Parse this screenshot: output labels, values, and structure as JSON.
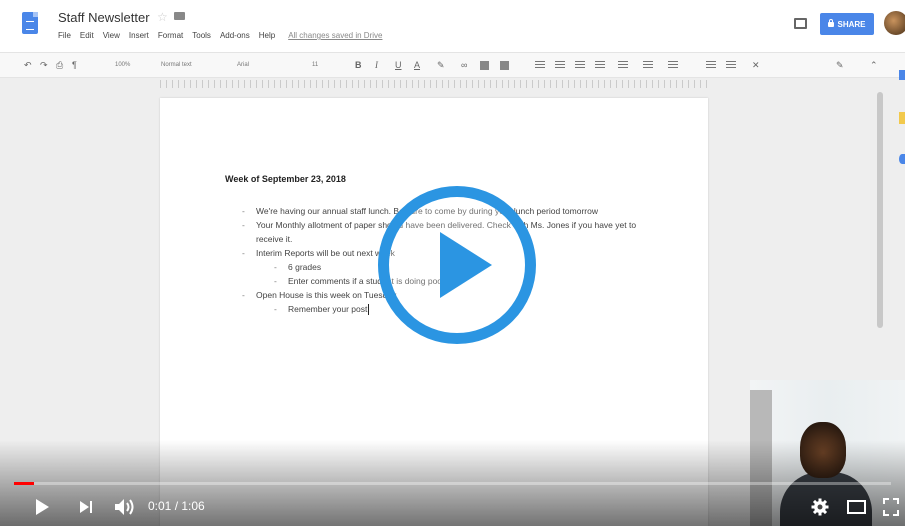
{
  "docs": {
    "title": "Staff Newsletter",
    "menu": [
      "File",
      "Edit",
      "View",
      "Insert",
      "Format",
      "Tools",
      "Add-ons",
      "Help"
    ],
    "save_status": "All changes saved in Drive",
    "share_label": "SHARE",
    "toolbar": {
      "zoom": "100%",
      "style": "Normal text",
      "font": "Arial",
      "font_size": "11"
    }
  },
  "document": {
    "heading": "Week of September 23, 2018",
    "items": [
      {
        "text": "We're having our annual staff lunch. Be sure to come by during your lunch period tomorrow",
        "level": 1
      },
      {
        "text": "Your Monthly allotment of paper should have been delivered. Check with Ms. Jones if you have yet to receive it.",
        "level": 1
      },
      {
        "text": "Interim Reports will be out next week",
        "level": 1
      },
      {
        "text": "6 grades",
        "level": 2
      },
      {
        "text": "Enter comments if a student is doing poorly",
        "level": 2
      },
      {
        "text": "Open House is this week on Tuesday",
        "level": 1
      },
      {
        "text": "Remember your post",
        "level": 2
      }
    ]
  },
  "player": {
    "time": "0:01 / 1:06",
    "progress": 0.015,
    "colors": {
      "progress": "#ff0000",
      "play_overlay": "#2b95e2"
    }
  },
  "icons": [
    "docs-logo-icon",
    "star-icon",
    "folder-icon",
    "comment-icon",
    "lock-icon",
    "play-icon",
    "next-icon",
    "volume-icon",
    "settings-icon",
    "theater-mode-icon",
    "fullscreen-icon"
  ]
}
